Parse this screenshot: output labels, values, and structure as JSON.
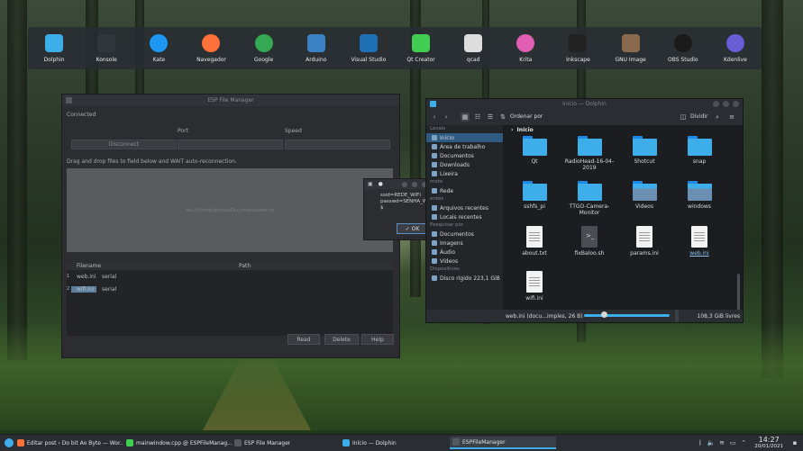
{
  "dock": {
    "items": [
      {
        "label": "Dolphin",
        "icon": "dolphin-icon",
        "color": "#3daee9"
      },
      {
        "label": "Konsole",
        "icon": "konsole-icon",
        "color": "#31363b"
      },
      {
        "label": "Kate",
        "icon": "kate-icon",
        "color": "#1d99f3"
      },
      {
        "label": "Navegador",
        "icon": "firefox-icon",
        "color": "#ff7139"
      },
      {
        "label": "Google",
        "icon": "chrome-icon",
        "color": "#34a853"
      },
      {
        "label": "Arduino",
        "icon": "arduino-icon",
        "color": "#3b82c4"
      },
      {
        "label": "Visual Studio",
        "icon": "vscode-icon",
        "color": "#1f6fb5"
      },
      {
        "label": "Qt Creator",
        "icon": "qtcreator-icon",
        "color": "#41cd52"
      },
      {
        "label": "qcad",
        "icon": "qcad-icon",
        "color": "#dddddd"
      },
      {
        "label": "Krita",
        "icon": "krita-icon",
        "color": "#e05fb2"
      },
      {
        "label": "Inkscape",
        "icon": "inkscape-icon",
        "color": "#222222"
      },
      {
        "label": "GNU Image",
        "icon": "gimp-icon",
        "color": "#8a6a4c"
      },
      {
        "label": "OBS Studio",
        "icon": "obs-icon",
        "color": "#1a1a1a"
      },
      {
        "label": "Kdenlive",
        "icon": "kdenlive-icon",
        "color": "#6a5cd6"
      }
    ]
  },
  "esp": {
    "title": "ESP File Manager",
    "status": "Connected",
    "port_label": "Port",
    "speed_label": "Speed",
    "disconnect_label": "Disconnect",
    "drag_hint": "Drag and drop files to field below and WAIT auto-reconnection.",
    "drop_text": "file:///home/djames/Documents/web.ini",
    "table": {
      "col_filename": "Filename",
      "col_path": "Path",
      "rows": [
        {
          "num": "1",
          "filename": "web.ini",
          "path": "serial"
        },
        {
          "num": "2",
          "filename": "wifi.ini",
          "path": "serial"
        }
      ]
    },
    "read_label": "Read",
    "delete_label": "Delete",
    "help_label": "Help"
  },
  "popup": {
    "line1": "ssid=REDE_WIFI",
    "line2": "passwd=SENHA_WIFI",
    "line3": "$",
    "ok_label": "OK"
  },
  "dolphin": {
    "title": "Início — Dolphin",
    "sort_label": "Ordenar por",
    "split_label": "Dividir",
    "breadcrumb": "Início",
    "sidebar": {
      "locais": "Locais",
      "items": [
        {
          "label": "Início",
          "selected": true
        },
        {
          "label": "Área de trabalho"
        },
        {
          "label": "Documentos"
        },
        {
          "label": "Downloads"
        },
        {
          "label": "Lixeira"
        }
      ],
      "remoto": "moto",
      "remote_items": [
        {
          "label": "Rede"
        }
      ],
      "recentes": "entes",
      "recent_items": [
        {
          "label": "Arquivos recentes"
        },
        {
          "label": "Locais recentes"
        }
      ],
      "pesquisar": "Pesquisar por",
      "search_items": [
        {
          "label": "Documentos"
        },
        {
          "label": "Imagens"
        },
        {
          "label": "Áudio"
        },
        {
          "label": "Vídeos"
        }
      ],
      "dispositivos": "Dispositivos",
      "device_items": [
        {
          "label": "Disco rígido 223,1 GiB"
        }
      ]
    },
    "files": [
      {
        "name": "Qt",
        "type": "folder"
      },
      {
        "name": "RadioHead-16-04-2019",
        "type": "folder"
      },
      {
        "name": "Shotcut",
        "type": "folder"
      },
      {
        "name": "snap",
        "type": "folder"
      },
      {
        "name": "sshfs_pi",
        "type": "folder"
      },
      {
        "name": "TTGO-Camera-Monitor",
        "type": "folder"
      },
      {
        "name": "Videos",
        "type": "folder-media"
      },
      {
        "name": "windows",
        "type": "folder-media"
      },
      {
        "name": "about.txt",
        "type": "doc"
      },
      {
        "name": "fixBaloo.sh",
        "type": "script"
      },
      {
        "name": "params.ini",
        "type": "doc"
      },
      {
        "name": "web.ini",
        "type": "doc",
        "selected": true
      },
      {
        "name": "wifi.ini",
        "type": "doc"
      }
    ],
    "status_text": "web.ini (docu...imples, 26 B)",
    "free_space": "108,3 GiB livres"
  },
  "taskbar": {
    "tasks": [
      {
        "label": "Editar post ‹ Do bit Ao Byte — Wor...",
        "color": "#ff7139"
      },
      {
        "label": "mainwindow.cpp @ ESPFileManag...",
        "color": "#41cd52"
      },
      {
        "label": "ESP File Manager",
        "color": "#555a60"
      },
      {
        "label": "Início — Dolphin",
        "color": "#3daee9"
      },
      {
        "label": "ESPFileManager",
        "color": "#555a60",
        "active": true
      }
    ],
    "time": "14:27",
    "date": "20/01/2021"
  }
}
